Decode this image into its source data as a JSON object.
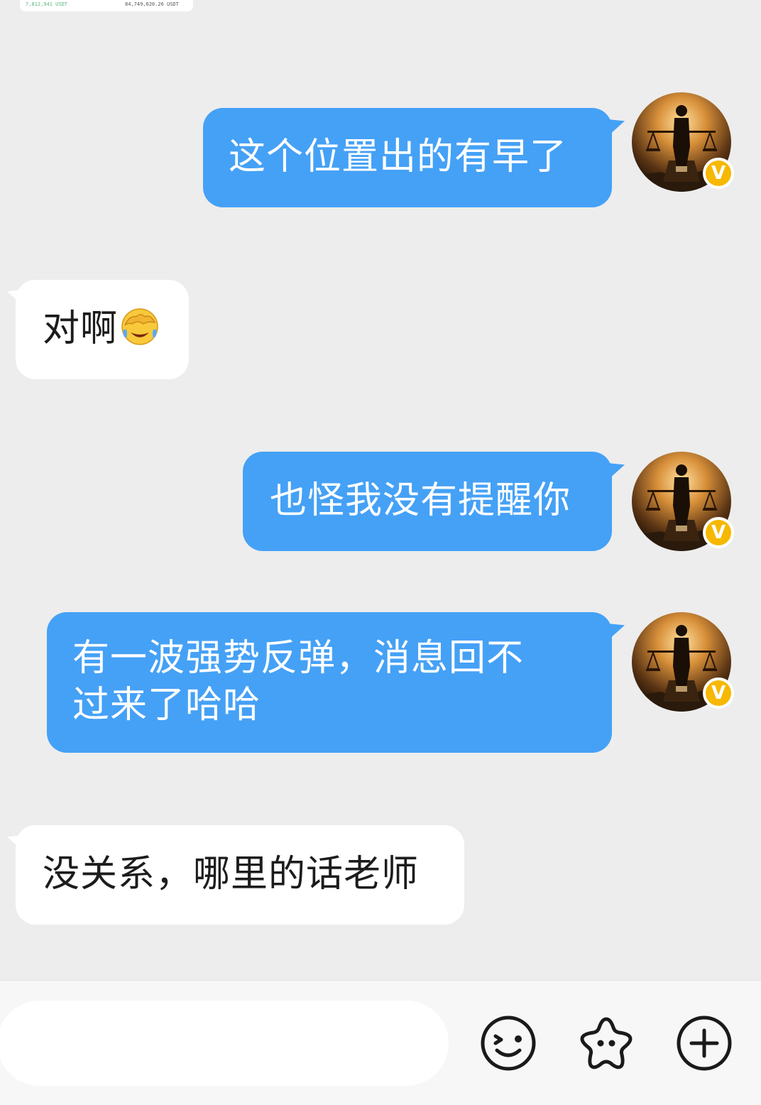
{
  "top_image": {
    "left_text": "7,812,941 USDT",
    "right_text": "84,749,620.26 USDT"
  },
  "messages": [
    {
      "direction": "outgoing",
      "text": "这个位置出的有早了",
      "avatar": "balance-scale-figure-avatar",
      "verified": "V"
    },
    {
      "direction": "incoming",
      "text": "对啊",
      "emoji": "face-palm-laughing-emoji"
    },
    {
      "direction": "outgoing",
      "text": "也怪我没有提醒你",
      "avatar": "balance-scale-figure-avatar",
      "verified": "V"
    },
    {
      "direction": "outgoing",
      "text_line1": "有一波强势反弹，消息回不",
      "text_line2": "过来了哈哈",
      "avatar": "balance-scale-figure-avatar",
      "verified": "V"
    },
    {
      "direction": "incoming",
      "text": "没关系，哪里的话老师"
    }
  ],
  "input_bar": {
    "placeholder": "",
    "icons": [
      "smiley-icon",
      "sticker-star-icon",
      "plus-icon"
    ]
  },
  "colors": {
    "outgoing_bubble": "#45a1f6",
    "incoming_bubble": "#ffffff",
    "background": "#ededed",
    "badge": "#f6b800"
  }
}
